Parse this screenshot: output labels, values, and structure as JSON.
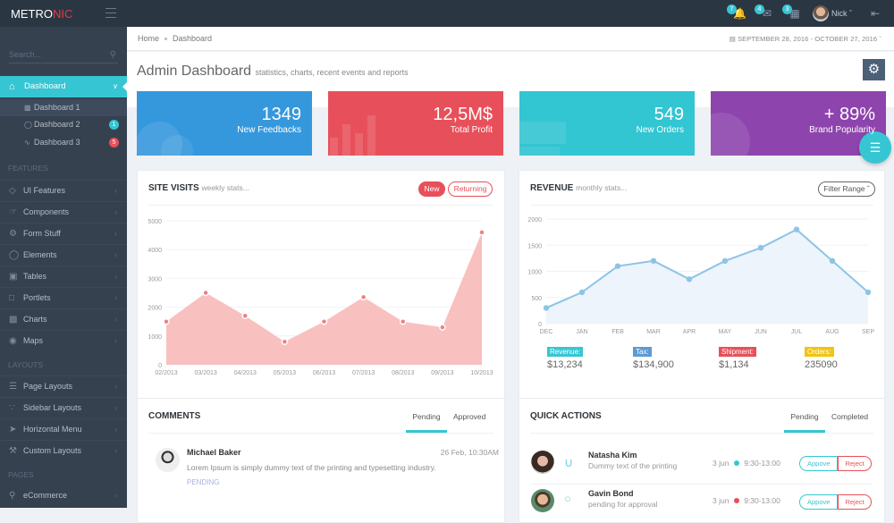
{
  "header": {
    "logo_left": "METRO",
    "logo_right": "NIC",
    "notifications": [
      {
        "icon": "bell-icon",
        "count": "7"
      },
      {
        "icon": "envelope-icon",
        "count": "4"
      },
      {
        "icon": "calendar-icon",
        "count": "3"
      }
    ],
    "user_name": "Nick"
  },
  "sidebar": {
    "search_placeholder": "Search...",
    "active": {
      "label": "Dashboard"
    },
    "sub_items": [
      {
        "label": "Dashboard 1",
        "badge": ""
      },
      {
        "label": "Dashboard 2",
        "badge": "1",
        "badge_color": "#36c6d3"
      },
      {
        "label": "Dashboard 3",
        "badge": "5",
        "badge_color": "#e7505a"
      }
    ],
    "sections": [
      {
        "title": "FEATURES",
        "items": [
          "UI Features",
          "Components",
          "Form Stuff",
          "Elements",
          "Tables",
          "Portlets",
          "Charts",
          "Maps"
        ]
      },
      {
        "title": "LAYOUTS",
        "items": [
          "Page Layouts",
          "Sidebar Layouts",
          "Horizontal Menu",
          "Custom Layouts"
        ]
      },
      {
        "title": "PAGES",
        "items": [
          "eCommerce"
        ]
      }
    ]
  },
  "breadcrumb": {
    "home": "Home",
    "current": "Dashboard"
  },
  "date_range": "SEPTEMBER 28, 2016 - OCTOBER 27, 2016",
  "page_title": {
    "main": "Admin Dashboard",
    "sub": "statistics, charts, recent events and reports"
  },
  "stats": [
    {
      "value": "1349",
      "label": "New Feedbacks",
      "color": "#3598dc"
    },
    {
      "value": "12,5M$",
      "label": "Total Profit",
      "color": "#e7505a"
    },
    {
      "value": "549",
      "label": "New Orders",
      "color": "#32c5d2"
    },
    {
      "value": "+ 89%",
      "label": "Brand Popularity",
      "color": "#8e44ad"
    }
  ],
  "site_visits": {
    "title": "SITE VISITS",
    "subtitle": "weekly stats...",
    "btn_new": "New",
    "btn_returning": "Returning"
  },
  "revenue": {
    "title": "REVENUE",
    "subtitle": "monthly stats...",
    "filter": "Filter Range",
    "summary": [
      {
        "label": "Revenue:",
        "value": "$13,234",
        "color": "#36c6d3"
      },
      {
        "label": "Tax:",
        "value": "$134,900",
        "color": "#5c9bd1"
      },
      {
        "label": "Shipment:",
        "value": "$1,134",
        "color": "#e7505a"
      },
      {
        "label": "Orders:",
        "value": "235090",
        "color": "#f1c40f"
      }
    ]
  },
  "chart_data": [
    {
      "type": "area",
      "title": "SITE VISITS",
      "categories": [
        "02/2013",
        "03/2013",
        "04/2013",
        "05/2013",
        "06/2013",
        "07/2013",
        "08/2013",
        "09/2013",
        "10/2013"
      ],
      "values": [
        1500,
        2500,
        1700,
        800,
        1500,
        2350,
        1500,
        1300,
        4600
      ],
      "yticks": [
        0,
        1000,
        2000,
        3000,
        4000,
        5000
      ],
      "ylim": [
        0,
        5000
      ],
      "color": "#f9c0c0",
      "point_color": "#f08080"
    },
    {
      "type": "line",
      "title": "REVENUE",
      "categories": [
        "DEC",
        "JAN",
        "FEB",
        "MAR",
        "APR",
        "MAY",
        "JUN",
        "JUL",
        "AUG",
        "SEP"
      ],
      "values": [
        300,
        600,
        1100,
        1200,
        850,
        1200,
        1450,
        1800,
        1200,
        600
      ],
      "yticks": [
        0,
        500,
        1000,
        1500,
        2000
      ],
      "ylim": [
        0,
        2000
      ],
      "color": "#8dc4e6",
      "fill": "#edf4fb"
    }
  ],
  "comments": {
    "title": "COMMENTS",
    "tabs": [
      "Pending",
      "Approved"
    ],
    "items": [
      {
        "name": "Michael Baker",
        "date": "26 Feb, 10:30AM",
        "text": "Lorem Ipsum is simply dummy text of the printing and typesetting industry.",
        "status": "PENDING"
      }
    ]
  },
  "quick_actions": {
    "title": "QUICK ACTIONS",
    "tabs": [
      "Pending",
      "Completed"
    ],
    "items": [
      {
        "name": "Natasha Kim",
        "desc": "Dummy text of the printing",
        "date": "3 jun",
        "time": "9:30-13:00",
        "dot": "#36c6d3",
        "approve": "Appove",
        "reject": "Reject"
      },
      {
        "name": "Gavin Bond",
        "desc": "pending for approval",
        "date": "3 jun",
        "time": "9:30-13:00",
        "dot": "#e7505a",
        "approve": "Appove",
        "reject": "Reject"
      }
    ]
  }
}
